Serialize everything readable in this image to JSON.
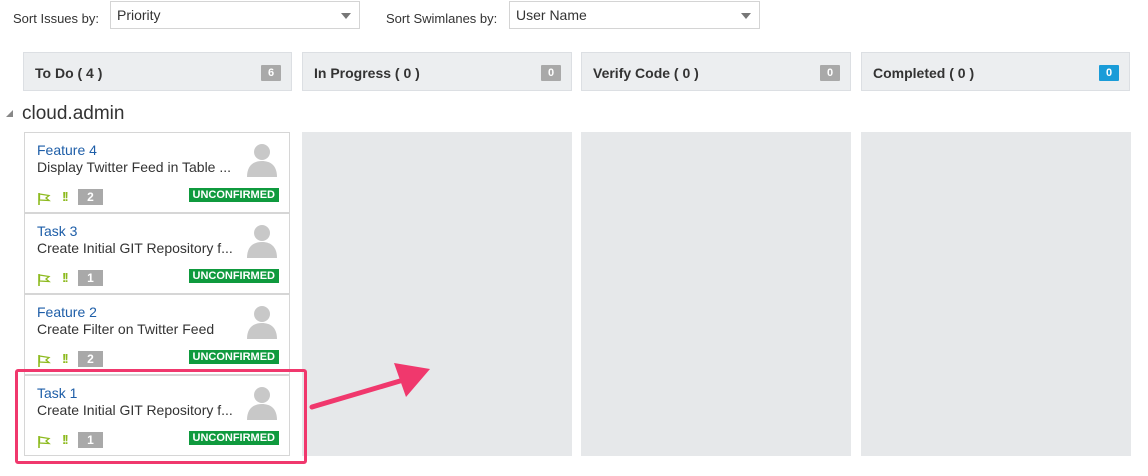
{
  "toolbar": {
    "sort_issues_label": "Sort Issues by:",
    "sort_issues_value": "Priority",
    "sort_swimlanes_label": "Sort Swimlanes by:",
    "sort_swimlanes_value": "User Name"
  },
  "columns": [
    {
      "title": "To Do ( 4 )",
      "count": "6",
      "count_color": "#a9a9a9"
    },
    {
      "title": "In Progress ( 0 )",
      "count": "0",
      "count_color": "#a9a9a9"
    },
    {
      "title": "Verify Code ( 0 )",
      "count": "0",
      "count_color": "#a9a9a9"
    },
    {
      "title": "Completed ( 0 )",
      "count": "0",
      "count_color": "#1a9cd8"
    }
  ],
  "swimlane": {
    "name": "cloud.admin",
    "cards": [
      {
        "id": "Feature 4",
        "summary": "Display Twitter Feed in Table ...",
        "priority": "!!",
        "points": "2",
        "status": "UNCONFIRMED"
      },
      {
        "id": "Task 3",
        "summary": "Create Initial GIT Repository f...",
        "priority": "!!",
        "points": "1",
        "status": "UNCONFIRMED"
      },
      {
        "id": "Feature 2",
        "summary": "Create Filter on Twitter Feed",
        "priority": "!!",
        "points": "2",
        "status": "UNCONFIRMED"
      },
      {
        "id": "Task 1",
        "summary": "Create Initial GIT Repository f...",
        "priority": "!!",
        "points": "1",
        "status": "UNCONFIRMED"
      }
    ]
  },
  "colors": {
    "accent_highlight": "#f0386d",
    "status_green": "#0f9a3e",
    "link_blue": "#1e5ea8"
  }
}
